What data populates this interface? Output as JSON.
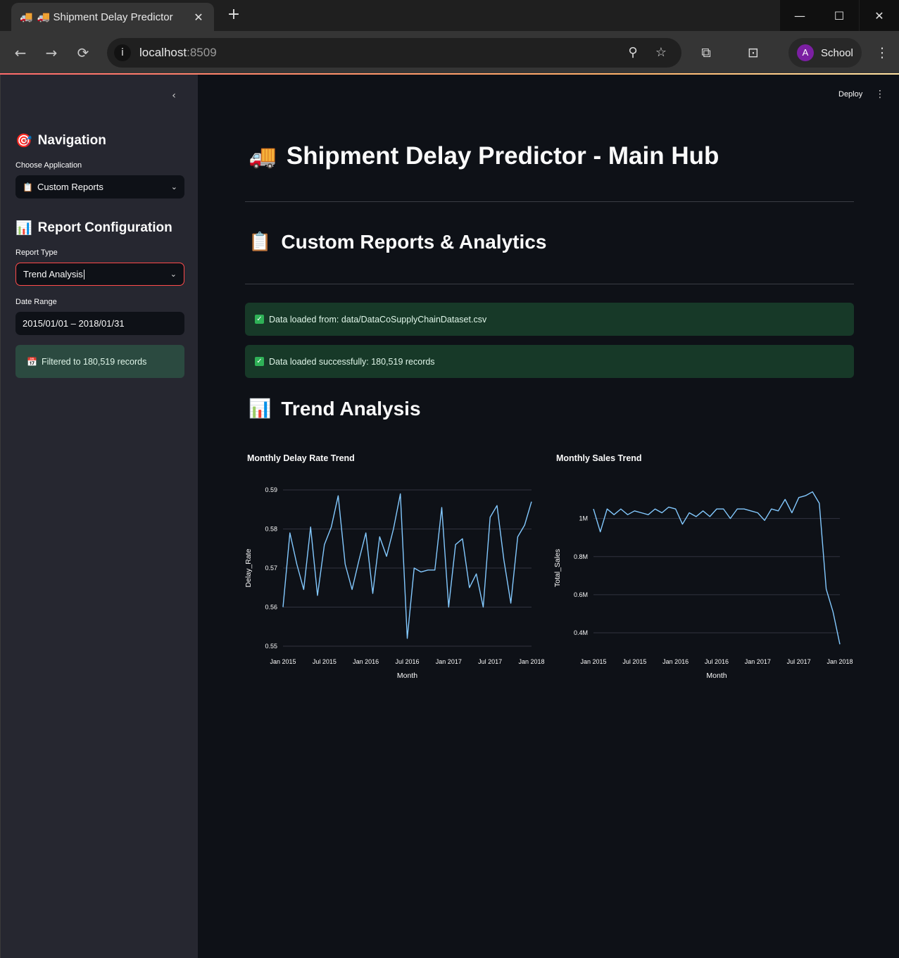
{
  "browser": {
    "tab": {
      "favicon": "🚚",
      "title": "🚚 Shipment Delay Predictor",
      "close": "✕"
    },
    "new_tab": "+",
    "window_controls": {
      "minimize": "—",
      "maximize": "☐",
      "close": "✕"
    },
    "nav": {
      "back": "←",
      "forward": "→",
      "reload": "⟳"
    },
    "address": {
      "host": "localhost",
      "port": ":8509"
    },
    "profile": {
      "initial": "A",
      "name": "School"
    }
  },
  "sidebar": {
    "collapse": "‹",
    "navigation": {
      "icon": "🎯",
      "heading": "Navigation",
      "label": "Choose Application",
      "selected_icon": "📋",
      "selected": "Custom Reports"
    },
    "report_config": {
      "icon": "📊",
      "heading": "Report Configuration",
      "type_label": "Report Type",
      "type_value": "Trend Analysis",
      "date_label": "Date Range",
      "date_value": "2015/01/01 – 2018/01/31"
    },
    "filter_info": {
      "icon": "📅",
      "text": "Filtered to 180,519 records"
    }
  },
  "main": {
    "deploy": "Deploy",
    "menu": "⋮",
    "title_icon": "🚚",
    "title": "Shipment Delay Predictor - Main Hub",
    "section_icon": "📋",
    "section": "Custom Reports & Analytics",
    "alerts": [
      "Data loaded from: data/DataCoSupplyChainDataset.csv",
      "Data loaded successfully: 180,519 records"
    ],
    "trend_icon": "📊",
    "trend_heading": "Trend Analysis"
  },
  "colors": {
    "line": "#83c9ff",
    "grid": "#31333f",
    "accent_red": "#ff4b4b",
    "success_bg": "#173928"
  },
  "chart_data": [
    {
      "type": "line",
      "title": "Monthly Delay Rate Trend",
      "xlabel": "Month",
      "ylabel": "Delay_Rate",
      "x_ticks": [
        "Jan 2015",
        "Jul 2015",
        "Jan 2016",
        "Jul 2016",
        "Jan 2017",
        "Jul 2017",
        "Jan 2018"
      ],
      "y_ticks": [
        "0.55",
        "0.56",
        "0.57",
        "0.58",
        "0.59"
      ],
      "ylim": [
        0.55,
        0.59
      ],
      "x": [
        "2015-01",
        "2015-02",
        "2015-03",
        "2015-04",
        "2015-05",
        "2015-06",
        "2015-07",
        "2015-08",
        "2015-09",
        "2015-10",
        "2015-11",
        "2015-12",
        "2016-01",
        "2016-02",
        "2016-03",
        "2016-04",
        "2016-05",
        "2016-06",
        "2016-07",
        "2016-08",
        "2016-09",
        "2016-10",
        "2016-11",
        "2016-12",
        "2017-01",
        "2017-02",
        "2017-03",
        "2017-04",
        "2017-05",
        "2017-06",
        "2017-07",
        "2017-08",
        "2017-09",
        "2017-10",
        "2017-11",
        "2017-12",
        "2018-01"
      ],
      "values": [
        0.56,
        0.579,
        0.571,
        0.5645,
        0.5805,
        0.563,
        0.576,
        0.5805,
        0.5885,
        0.571,
        0.5645,
        0.572,
        0.579,
        0.5635,
        0.578,
        0.573,
        0.58,
        0.589,
        0.552,
        0.57,
        0.569,
        0.5695,
        0.5695,
        0.5855,
        0.56,
        0.576,
        0.5775,
        0.565,
        0.5685,
        0.56,
        0.583,
        0.586,
        0.572,
        0.561,
        0.578,
        0.581,
        0.587
      ]
    },
    {
      "type": "line",
      "title": "Monthly Sales Trend",
      "xlabel": "Month",
      "ylabel": "Total_Sales",
      "x_ticks": [
        "Jan 2015",
        "Jul 2015",
        "Jan 2016",
        "Jul 2016",
        "Jan 2017",
        "Jul 2017",
        "Jan 2018"
      ],
      "y_ticks": [
        "0.4M",
        "0.6M",
        "0.8M",
        "1M"
      ],
      "ylim": [
        0.33,
        1.15
      ],
      "x": [
        "2015-01",
        "2015-02",
        "2015-03",
        "2015-04",
        "2015-05",
        "2015-06",
        "2015-07",
        "2015-08",
        "2015-09",
        "2015-10",
        "2015-11",
        "2015-12",
        "2016-01",
        "2016-02",
        "2016-03",
        "2016-04",
        "2016-05",
        "2016-06",
        "2016-07",
        "2016-08",
        "2016-09",
        "2016-10",
        "2016-11",
        "2016-12",
        "2017-01",
        "2017-02",
        "2017-03",
        "2017-04",
        "2017-05",
        "2017-06",
        "2017-07",
        "2017-08",
        "2017-09",
        "2017-10",
        "2017-11",
        "2017-12",
        "2018-01"
      ],
      "values": [
        1.05,
        0.93,
        1.05,
        1.02,
        1.05,
        1.02,
        1.04,
        1.03,
        1.02,
        1.05,
        1.03,
        1.06,
        1.05,
        0.97,
        1.03,
        1.01,
        1.04,
        1.01,
        1.05,
        1.05,
        1.0,
        1.05,
        1.05,
        1.04,
        1.03,
        0.99,
        1.05,
        1.04,
        1.1,
        1.03,
        1.11,
        1.12,
        1.14,
        1.08,
        0.63,
        0.51,
        0.34
      ]
    }
  ]
}
